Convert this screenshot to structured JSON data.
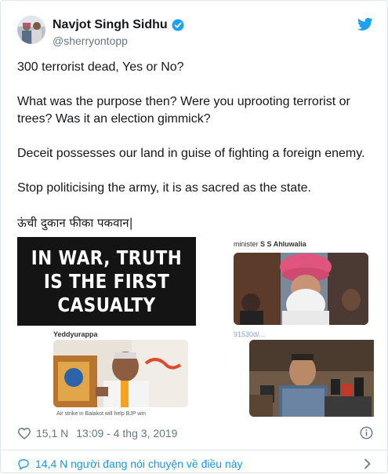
{
  "author": {
    "name": "Navjot Singh Sidhu",
    "handle": "@sherryontopp"
  },
  "tweet": {
    "paragraphs": [
      "300 terrorist dead, Yes or No?",
      "What was the purpose then? Were you uprooting terrorist or trees? Was it an election gimmick?",
      "Deceit possesses our land in guise of fighting a foreign enemy.",
      "Stop politicising the army, it is as sacred as the state."
    ],
    "hindi_line": "ऊंची दुकान फीका पकवान|"
  },
  "media": {
    "quote_lines": [
      "IN WAR, TRUTH",
      "IS THE FIRST",
      "CASUALTY"
    ],
    "tile2_caption_prefix": "minister ",
    "tile2_caption_name": "S S Ahluwalia",
    "tile3_caption_top": "Yeddyurappa",
    "tile3_caption_bottom": "Air strike in Balakot will help BJP win",
    "tile4_caption_top": "91530d/..."
  },
  "footer": {
    "like_count": "15,1 N",
    "timestamp": "13:09 - 4 thg 3, 2019",
    "conversation": "14,4 N người đang nói chuyện về điều này"
  },
  "colors": {
    "accent": "#1da1f2",
    "link": "#1b95e0",
    "muted": "#657786",
    "like": "#e0245e"
  },
  "icons": {
    "verified": "verified-badge-icon",
    "bird": "twitter-bird-icon",
    "like": "heart-icon",
    "info": "info-icon",
    "conversation": "speech-bubble-icon",
    "chevron": "chevron-right-icon"
  }
}
